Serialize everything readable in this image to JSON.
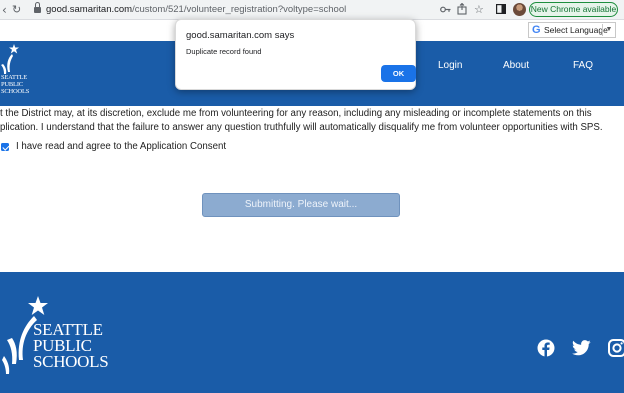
{
  "browser": {
    "url_host": "good.samaritan.com",
    "url_path": "/custom/521/volunteer_registration?voltype=school",
    "update_chip": "New Chrome available",
    "icons": [
      "back-icon",
      "reload-icon",
      "lock-icon",
      "key-icon",
      "share-icon",
      "star-icon",
      "side-panel-icon",
      "profile-avatar",
      "more-menu-icon"
    ]
  },
  "translate": {
    "label": "Select Language",
    "arrow": "▼"
  },
  "header": {
    "logo_text": [
      "SEATTLE",
      "PUBLIC",
      "SCHOOLS"
    ],
    "nav": {
      "login": "Login",
      "about": "About",
      "faq": "FAQ"
    }
  },
  "content": {
    "consent_line_1": "t the District may, at its discretion, exclude me from volunteering for any reason, including any misleading or incomplete statements on this",
    "consent_line_2": "plication. I understand that the failure to answer any question truthfully will automatically disqualify me from volunteer opportunities with SPS.",
    "checkbox_label": "I have read and agree to the Application Consent",
    "checkbox_checked": true,
    "submit_label": "Submitting. Please wait..."
  },
  "footer": {
    "logo_lines": [
      "SEATTLE",
      "PUBLIC",
      "SCHOOLS"
    ],
    "social_icons": [
      "facebook-icon",
      "twitter-icon",
      "instagram-icon"
    ]
  },
  "dialog": {
    "title": "good.samaritan.com says",
    "message": "Duplicate record found",
    "ok_label": "OK"
  },
  "colors": {
    "brand_blue": "#1a5ca8",
    "button_disabled": "#8cabd0",
    "chrome_blue": "#1a73e8",
    "update_green": "#137333"
  }
}
